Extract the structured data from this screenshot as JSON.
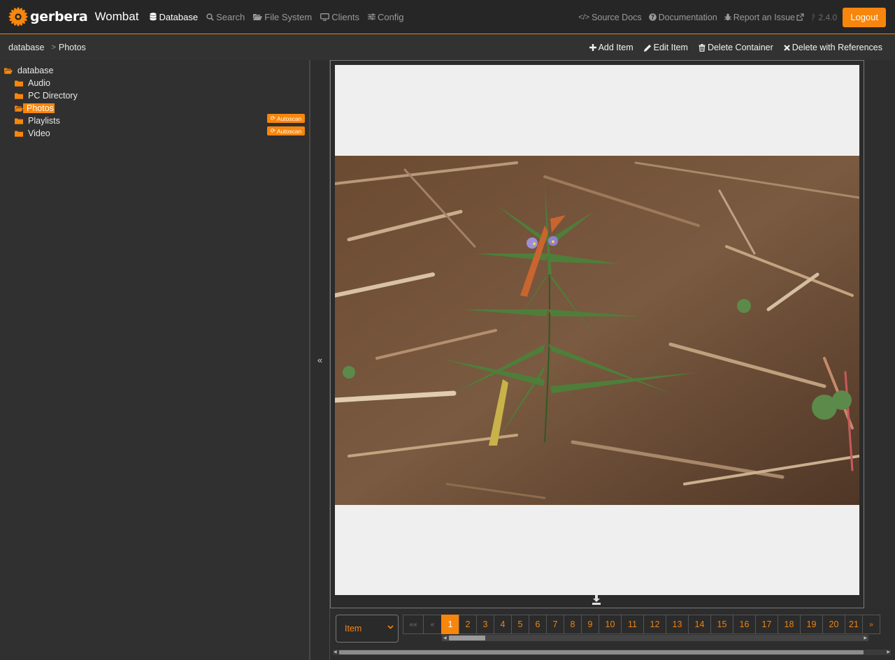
{
  "brand": {
    "name": "gerbera",
    "subtitle": "Wombat"
  },
  "nav": [
    {
      "label": "Database",
      "icon": "database-icon",
      "active": true
    },
    {
      "label": "Search",
      "icon": "search-icon"
    },
    {
      "label": "File System",
      "icon": "folder-open-icon"
    },
    {
      "label": "Clients",
      "icon": "desktop-icon"
    },
    {
      "label": "Config",
      "icon": "sliders-icon"
    }
  ],
  "nav_right": {
    "source_docs": "Source Docs",
    "documentation": "Documentation",
    "report_issue": "Report an Issue",
    "version": "2.4.0",
    "logout": "Logout"
  },
  "breadcrumb": {
    "root": "database",
    "sep": ">",
    "current": "Photos"
  },
  "toolbar": {
    "add_item": "Add Item",
    "edit_item": "Edit Item",
    "delete_container": "Delete Container",
    "delete_with_references": "Delete with References"
  },
  "tree": {
    "root": "database",
    "items": [
      {
        "label": "Audio",
        "selected": false,
        "autoscan": false
      },
      {
        "label": "PC Directory",
        "selected": false,
        "autoscan": false
      },
      {
        "label": "Photos",
        "selected": true,
        "autoscan": false
      },
      {
        "label": "Playlists",
        "selected": false,
        "autoscan": true
      },
      {
        "label": "Video",
        "selected": false,
        "autoscan": true
      }
    ],
    "autoscan_label": "Autoscan"
  },
  "collapse_label": "«",
  "pager": {
    "type_value": "Item",
    "first": "««",
    "prev": "«",
    "pages": [
      "1",
      "2",
      "3",
      "4",
      "5",
      "6",
      "7",
      "8",
      "9",
      "10",
      "11",
      "12",
      "13",
      "14",
      "15",
      "16",
      "17",
      "18",
      "19",
      "20",
      "21"
    ],
    "active_page": "1",
    "next": "»"
  },
  "colors": {
    "accent": "#f8860d",
    "background": "#303030",
    "navbar": "#262626"
  }
}
